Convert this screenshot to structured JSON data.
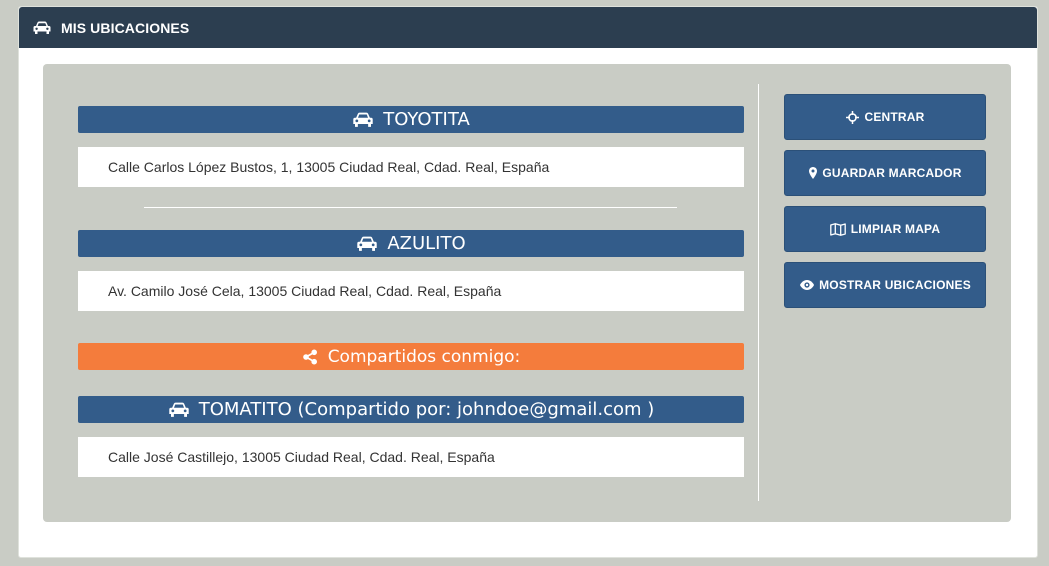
{
  "header": {
    "title": "MIS UBICACIONES",
    "icon": "car-icon"
  },
  "locations": [
    {
      "name": "TOYOTITA",
      "address": "Calle Carlos López Bustos, 1, 13005 Ciudad Real, Cdad. Real, España"
    },
    {
      "name": "AZULITO",
      "address": "Av. Camilo José Cela, 13005 Ciudad Real, Cdad. Real, España"
    }
  ],
  "shared": {
    "heading": "Compartidos conmigo:",
    "items": [
      {
        "name": "TOMATITO (Compartido por: johndoe@gmail.com )",
        "address": "Calle José Castillejo, 13005 Ciudad Real, Cdad. Real, España"
      }
    ]
  },
  "actions": {
    "center": "CENTRAR",
    "save_marker": "GUARDAR MARCADOR",
    "clear_map": "LIMPIAR MAPA",
    "show_locations": "MOSTRAR UBICACIONES"
  },
  "colors": {
    "header_bg": "#2c3e50",
    "primary": "#335c8a",
    "accent_orange": "#f47c3c",
    "well_bg": "#c9ccc5"
  }
}
